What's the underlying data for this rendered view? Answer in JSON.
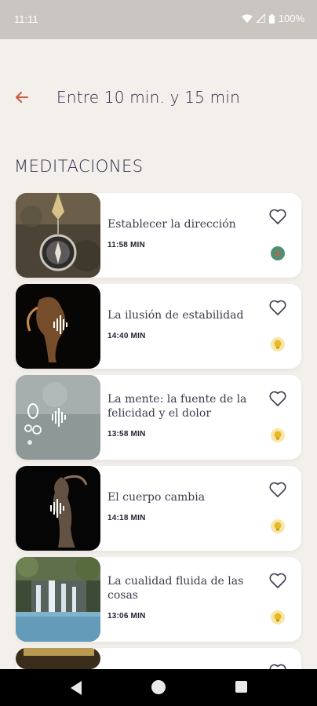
{
  "status": {
    "time": "11:11",
    "battery": "100%"
  },
  "header": {
    "title": "Entre 10 min. y 15 min",
    "back_icon": "arrow-left-icon"
  },
  "section_title": "MEDITACIONES",
  "colors": {
    "accent": "#d2563c",
    "navy": "#2b2d4a",
    "background": "#f3efea"
  },
  "items": [
    {
      "title": "Establecer la dirección",
      "duration": "11:58 MIN",
      "level_icon": "lotus-icon",
      "level_color": "#d95b3f",
      "favorite": false
    },
    {
      "title": "La ilusión de estabilidad",
      "duration": "14:40 MIN",
      "level_icon": "lightbulb-icon",
      "level_color": "#e9b827",
      "favorite": false
    },
    {
      "title": "La mente: la fuente de la felicidad y el dolor",
      "duration": "13:58 MIN",
      "level_icon": "lightbulb-icon",
      "level_color": "#e9b827",
      "favorite": false
    },
    {
      "title": "El cuerpo cambia",
      "duration": "14:18 MIN",
      "level_icon": "lightbulb-icon",
      "level_color": "#e9b827",
      "favorite": false
    },
    {
      "title": "La cualidad fluida de las cosas",
      "duration": "13:06 MIN",
      "level_icon": "lightbulb-icon",
      "level_color": "#e9b827",
      "favorite": false
    }
  ]
}
